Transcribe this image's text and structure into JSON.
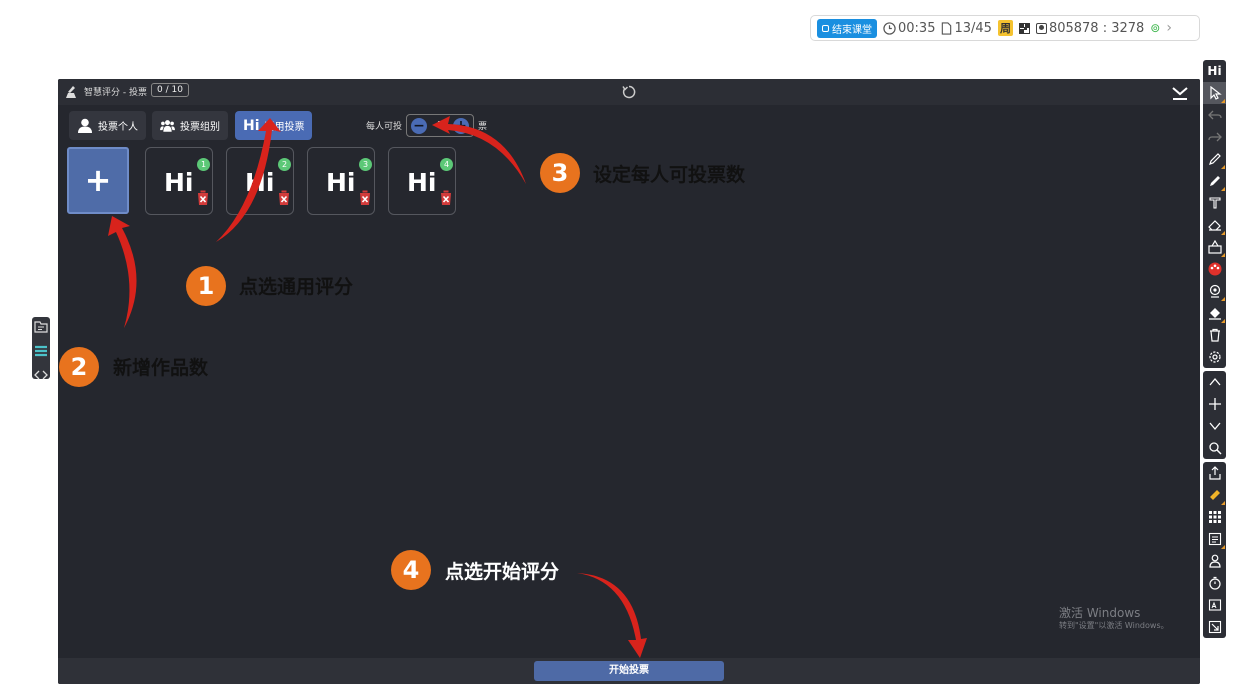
{
  "topbar": {
    "end_class": "结束课堂",
    "timer": "00:35",
    "pages": "13/45",
    "week_badge": "周",
    "room": "805878 : 3278"
  },
  "panel": {
    "title": "智慧评分 - 投票",
    "counter": "0 / 10"
  },
  "tabs": [
    {
      "label": "投票个人",
      "icon": "person-icon"
    },
    {
      "label": "投票组别",
      "icon": "group-icon"
    },
    {
      "label": "通用投票",
      "icon": "hi-icon",
      "glyph": "Hi"
    }
  ],
  "vote_control": {
    "label": "每人可投",
    "value": "1",
    "unit": "票",
    "minus": "−",
    "plus": "+"
  },
  "add_card": {
    "label": "+"
  },
  "cards": [
    {
      "text": "Hi",
      "number": "1"
    },
    {
      "text": "Hi",
      "number": "2"
    },
    {
      "text": "Hi",
      "number": "3"
    },
    {
      "text": "Hi",
      "number": "4"
    }
  ],
  "watermark": {
    "line1": "激活 Windows",
    "line2": "转到\"设置\"以激活 Windows。"
  },
  "footer": {
    "start_button": "开始投票"
  },
  "right_toolbar": {
    "logo": "Hi"
  },
  "annotations": [
    {
      "number": "1",
      "text": "点选通用评分"
    },
    {
      "number": "2",
      "text": "新增作品数"
    },
    {
      "number": "3",
      "text": "设定每人可投票数"
    },
    {
      "number": "4",
      "text": "点选开始评分"
    }
  ],
  "colors": {
    "panel_bg": "#25272e",
    "accent": "#4a6bb4",
    "badge_green": "#5cc877",
    "annotation_orange": "#e8731e",
    "arrow_red": "#d8231c"
  }
}
